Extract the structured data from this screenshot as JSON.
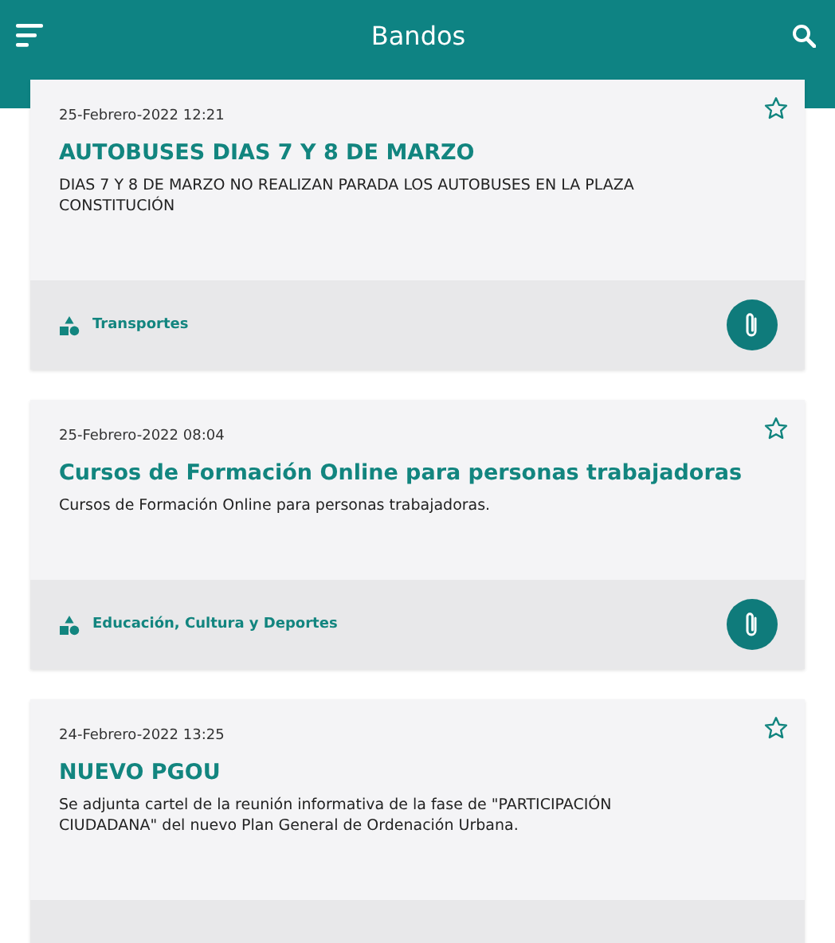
{
  "app_bar": {
    "title": "Bandos"
  },
  "notices": [
    {
      "date": "25-Febrero-2022 12:21",
      "title": "AUTOBUSES DIAS 7 Y 8 DE MARZO",
      "text": "DIAS 7 Y 8 DE MARZO NO REALIZAN PARADA LOS AUTOBUSES EN LA PLAZA CONSTITUCIÓN",
      "favorite": false,
      "category": "Transportes",
      "attachment": true
    },
    {
      "date": "25-Febrero-2022 08:04",
      "title": "Cursos de Formación Online para personas trabajadoras",
      "text": "Cursos de Formación Online para personas trabajadoras.",
      "favorite": false,
      "category": "Educación, Cultura y Deportes",
      "attachment": true
    },
    {
      "date": "24-Febrero-2022 13:25",
      "title": "NUEVO PGOU",
      "text": "Se adjunta cartel de la reunión informativa de la fase de \"PARTICIPACIÓN CIUDADANA\" del nuevo Plan General de Ordenación Urbana.",
      "favorite": false
    }
  ]
}
